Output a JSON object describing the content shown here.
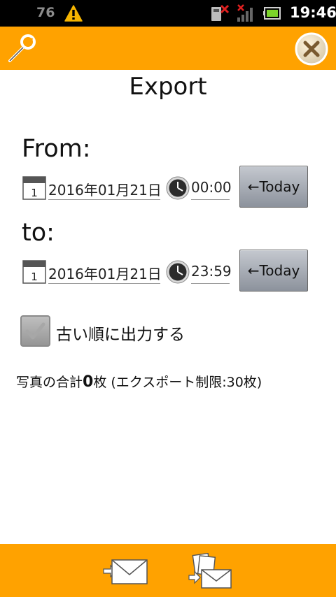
{
  "status_bar": {
    "level_text": "76",
    "clock": "19:46",
    "icons": [
      "warning-icon",
      "sim-error-icon",
      "no-signal-icon",
      "battery-icon"
    ]
  },
  "top_bar": {
    "color": "#ffa200",
    "left_icon": "wrench-icon",
    "right_icon": "close-icon"
  },
  "title": "Export",
  "from": {
    "label": "From:",
    "date": "2016年01月21日",
    "time": "00:00",
    "today_label": "←Today"
  },
  "to": {
    "label": "to:",
    "date": "2016年01月21日",
    "time": "23:59",
    "today_label": "←Today"
  },
  "option": {
    "label": "古い順に出力する",
    "checked": true
  },
  "summary": {
    "prefix": "写真の合計",
    "count": "0",
    "suffix": "枚 (エクスポート制限:30枚)"
  },
  "bottom_bar": {
    "buttons": [
      "send-mail-icon",
      "send-multiple-mail-icon"
    ]
  }
}
